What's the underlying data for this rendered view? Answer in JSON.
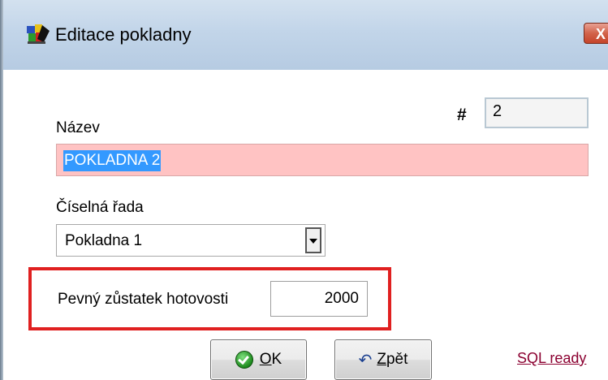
{
  "window": {
    "title": "Editace pokladny",
    "close_label": "X",
    "app_icon": "app-icon"
  },
  "form": {
    "id_label": "#",
    "id_value": "2",
    "name_label": "Název",
    "name_value": "POKLADNA 2",
    "series_label": "Číselná řada",
    "series_value": "Pokladna 1",
    "cash_label": "Pevný zůstatek hotovosti",
    "cash_value": "2000"
  },
  "buttons": {
    "ok_mnemonic": "O",
    "ok_rest": "K",
    "back_mnemonic": "Z",
    "back_rest": "pět"
  },
  "status": {
    "sql_link": "SQL ready"
  },
  "colors": {
    "name_bg": "#ffc3c3",
    "highlight": "#e02020",
    "link": "#8b0030"
  }
}
